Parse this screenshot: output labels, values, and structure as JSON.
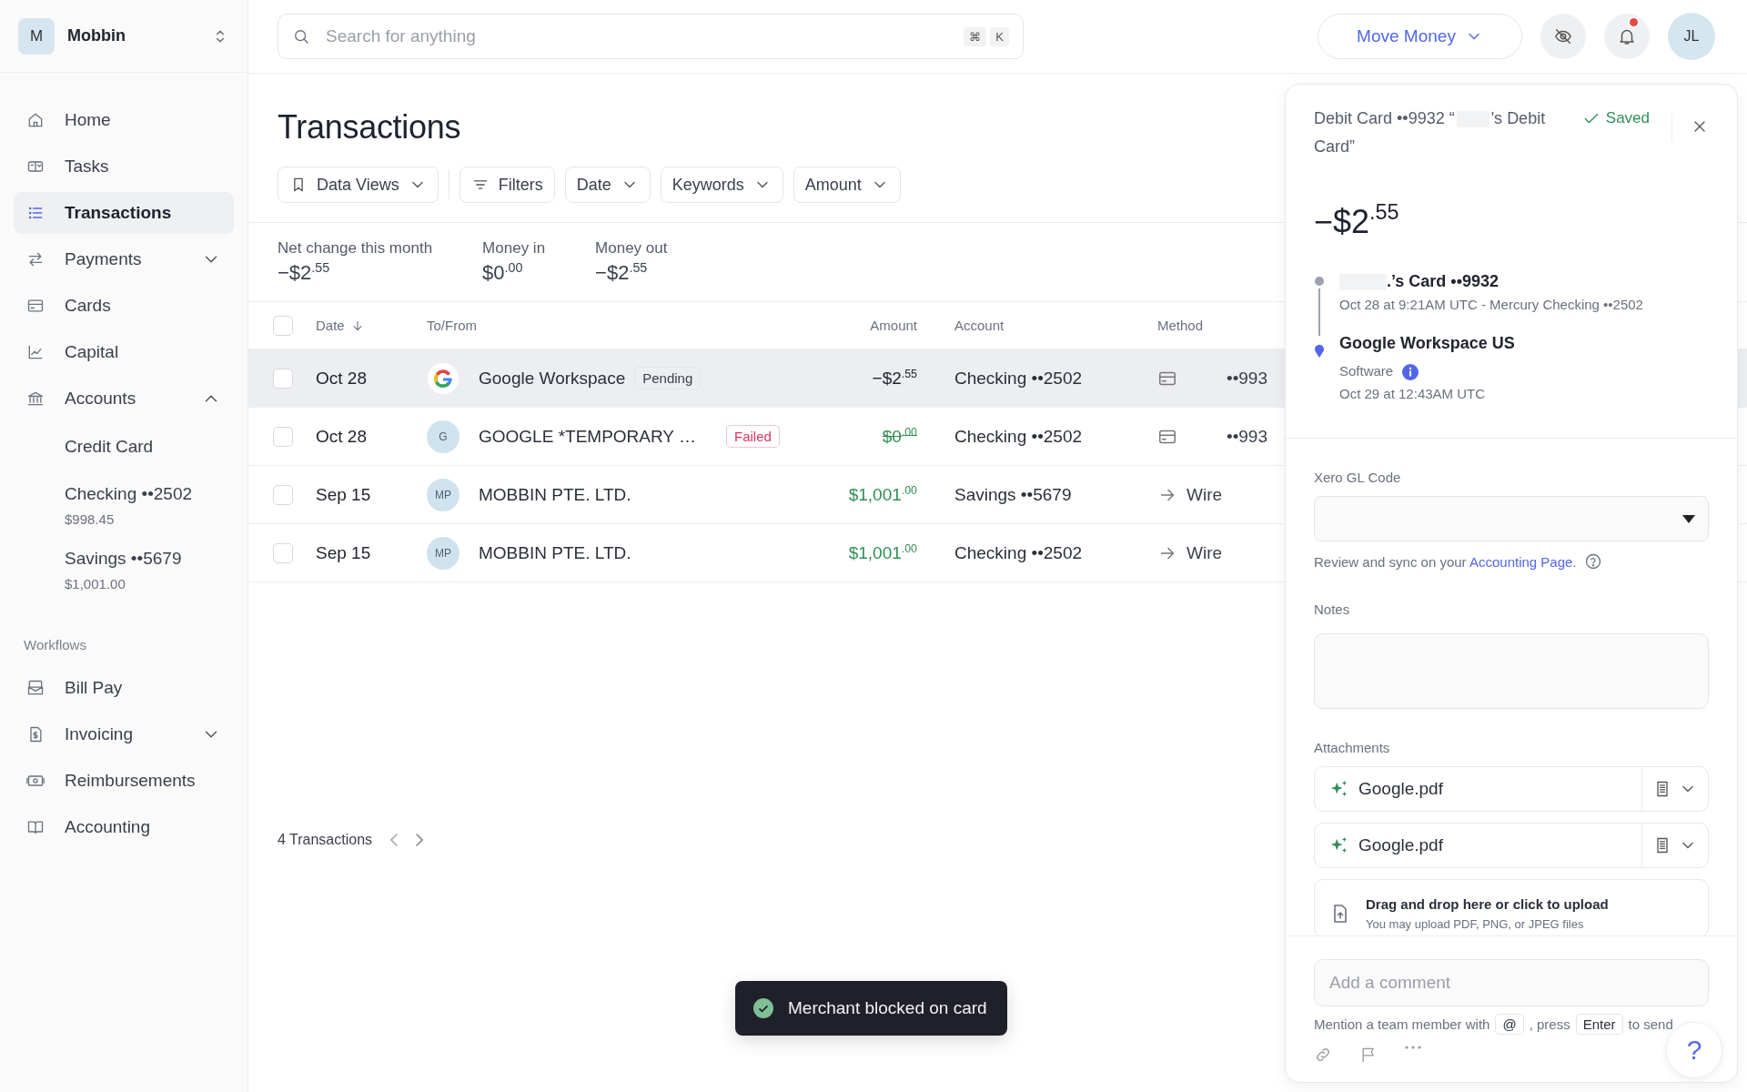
{
  "workspace": {
    "initial": "M",
    "name": "Mobbin"
  },
  "nav": [
    {
      "label": "Home",
      "selected": false
    },
    {
      "label": "Tasks",
      "selected": false
    },
    {
      "label": "Transactions",
      "selected": true
    },
    {
      "label": "Payments",
      "selected": false,
      "expanded": false
    },
    {
      "label": "Cards",
      "selected": false
    },
    {
      "label": "Capital",
      "selected": false
    },
    {
      "label": "Accounts",
      "selected": false,
      "expanded": true,
      "children": [
        {
          "label": "Credit Card"
        },
        {
          "label": "Checking ••2502",
          "balance": "$998.45"
        },
        {
          "label": "Savings ••5679",
          "balance": "$1,001.00"
        }
      ]
    }
  ],
  "workflows": {
    "title": "Workflows",
    "items": [
      {
        "label": "Bill Pay",
        "selected": false
      },
      {
        "label": "Invoicing",
        "selected": false,
        "expanded": false
      },
      {
        "label": "Reimbursements",
        "selected": false
      },
      {
        "label": "Accounting",
        "selected": false
      }
    ]
  },
  "search": {
    "placeholder": "Search for anything",
    "shortcut": [
      "⌘",
      "K"
    ]
  },
  "move_money": {
    "label": "Move Money"
  },
  "notifications": {
    "unread": true
  },
  "avatar": {
    "initials": "JL"
  },
  "page_title": "Transactions",
  "filters": [
    {
      "label": "Data Views",
      "kind": "views"
    },
    {
      "label": "Filters",
      "kind": "filters"
    },
    {
      "label": "Date",
      "kind": "dropdown"
    },
    {
      "label": "Keywords",
      "kind": "dropdown"
    },
    {
      "label": "Amount",
      "kind": "dropdown"
    }
  ],
  "summary": [
    {
      "label": "Net change this month",
      "value": "−$2$^{.55}$"
    },
    {
      "label": "Money in",
      "value": "$0$^{.00}$"
    },
    {
      "label": "Money out",
      "value": "−$2$^{.55}$"
    }
  ],
  "table": {
    "select_all": {
      "checked": false
    },
    "columns": [
      {
        "label": "Date",
        "sorted": true
      },
      {
        "label": "To/From",
        "sorted": false
      },
      {
        "label": "Amount",
        "sorted": false
      },
      {
        "label": "Account",
        "sorted": false
      },
      {
        "label": "Method",
        "sorted": false
      }
    ],
    "rows": [
      {
        "checked": false,
        "selected": true,
        "date": "Oct 28",
        "avatar": {
          "kind": "logo"
        },
        "name": "Google Workspace",
        "status": {
          "label": "Pending",
          "kind": "pending"
        },
        "amount": "−$2$^{.55}$",
        "incoming": false,
        "voided": false,
        "account": "Checking ••2502",
        "method": {
          "kind": "card",
          "text": "••993"
        }
      },
      {
        "checked": false,
        "selected": false,
        "date": "Oct 28",
        "avatar": {
          "kind": "initials",
          "text": "G"
        },
        "name": "GOOGLE *TEMPORARY …",
        "status": {
          "label": "Failed",
          "kind": "failed"
        },
        "amount": "$0$^{.00}$",
        "incoming": true,
        "voided": true,
        "account": "Checking ••2502",
        "method": {
          "kind": "card",
          "text": "••993"
        }
      },
      {
        "checked": false,
        "selected": false,
        "date": "Sep 15",
        "avatar": {
          "kind": "initials",
          "text": "MP"
        },
        "name": "MOBBIN PTE. LTD.",
        "amount": "$1,001$^{.00}$",
        "incoming": true,
        "voided": false,
        "account": "Savings ••5679",
        "method": {
          "kind": "wire",
          "text": "Wire"
        }
      },
      {
        "checked": false,
        "selected": false,
        "date": "Sep 15",
        "avatar": {
          "kind": "initials",
          "text": "MP"
        },
        "name": "MOBBIN PTE. LTD.",
        "amount": "$1,001$^{.00}$",
        "incoming": true,
        "voided": false,
        "account": "Checking ••2502",
        "method": {
          "kind": "wire",
          "text": "Wire"
        }
      }
    ]
  },
  "pagination": {
    "count": "4 Transactions"
  },
  "detail": {
    "title_parts": [
      "Debit Card ••9932 “",
      "'s Debit Card”"
    ],
    "saved": "Saved",
    "amount": "−$2$^{.55}$",
    "from": {
      "name": ".’s Card ••9932",
      "detail": "Oct 28 at 9:21AM UTC - Mercury Checking ••2502"
    },
    "to": {
      "name": "Google Workspace US",
      "category": "Software",
      "time": "Oct 29 at 12:43AM UTC"
    },
    "gl_code": {
      "label": "Xero GL Code"
    },
    "gl_help": {
      "before": "Review and sync on your ",
      "link": "Accounting Page",
      "after": "."
    },
    "notes": {
      "label": "Notes"
    },
    "attachments": {
      "label": "Attachments",
      "files": [
        "Google.pdf",
        "Google.pdf"
      ],
      "upload_title": "Drag and drop here or click to upload",
      "upload_hint": "You may upload PDF, PNG, or JPEG files"
    },
    "comment": {
      "placeholder": "Add a comment",
      "hint_parts": [
        "Mention a team member with",
        ", press",
        "to send"
      ],
      "keys": [
        "@",
        "Enter"
      ]
    },
    "help_button": "?"
  },
  "toast": {
    "message": "Merchant blocked on card"
  }
}
